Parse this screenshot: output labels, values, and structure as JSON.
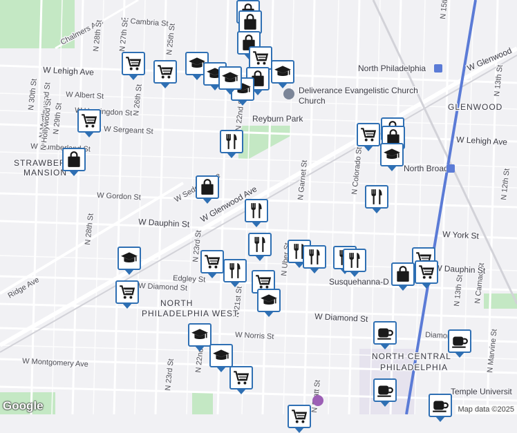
{
  "map": {
    "streets": [
      "W Cambria St",
      "Chalmers Ave",
      "W Lehigh Ave",
      "W Albert St",
      "W Huntingdon St",
      "W Sergeant St",
      "W Cumberland St",
      "W Sedgley Ave",
      "W Gordon St",
      "W Dauphin St",
      "W Glenwood Ave",
      "Ridge Ave",
      "W Diamond St",
      "Edgley St",
      "W Norris St",
      "W Montgomery Ave",
      "N 29th St",
      "N 28th St",
      "N 27th St",
      "N 26th St",
      "N 25th St",
      "N 22nd St",
      "N 23rd St",
      "N 21st St",
      "N Uber St",
      "N Garnet St",
      "N 30th St",
      "N Myrtlewood St",
      "N Hollywood St",
      "W York St",
      "N 13th St",
      "N Camac St",
      "N Marvine St",
      "N 12th St",
      "N Pratt St",
      "N Colorado St",
      "W Glenwood",
      "W Lehigh Ave",
      "N 15th St",
      "N 13th St",
      "Edgley St",
      "W Diamond St",
      "Susquehanna-D",
      "Diamond",
      "W Dauphin St",
      "N 28th St",
      "N 23rd St",
      "N 22nd St"
    ],
    "places": [
      "North Philadelphia",
      "Deliverance Evangelistic Church",
      "Reyburn Park",
      "North Broad",
      "Temple Universit"
    ],
    "areas": [
      "GLENWOOD",
      "STRAWBERRY MANSION",
      "NORTH PHILADELPHIA WEST",
      "NORTH CENTRAL PHILADELPHIA"
    ],
    "attribution": "Map data ©2025",
    "logo": "Google",
    "colors": {
      "pin_border": "#2e6fb3",
      "park": "#c4e8c4",
      "rail": "#5b7bd6",
      "road": "#ffffff",
      "background": "#f1f1f4"
    }
  },
  "pins": [
    {
      "icon": "shopping-bag-icon"
    },
    {
      "icon": "shopping-bag-icon"
    },
    {
      "icon": "shopping-bag-icon"
    },
    {
      "icon": "shopping-cart-icon"
    },
    {
      "icon": "school-icon"
    },
    {
      "icon": "shopping-cart-icon"
    },
    {
      "icon": "shopping-cart-icon"
    },
    {
      "icon": "school-icon"
    },
    {
      "icon": "school-icon"
    },
    {
      "icon": "shopping-bag-icon"
    },
    {
      "icon": "school-icon"
    },
    {
      "icon": "school-icon"
    },
    {
      "icon": "shopping-cart-icon"
    },
    {
      "icon": "restaurant-icon"
    },
    {
      "icon": "shopping-bag-icon"
    },
    {
      "icon": "shopping-bag-icon"
    },
    {
      "icon": "shopping-cart-icon"
    },
    {
      "icon": "shopping-bag-icon"
    },
    {
      "icon": "school-icon"
    },
    {
      "icon": "restaurant-icon"
    },
    {
      "icon": "shopping-bag-icon"
    },
    {
      "icon": "restaurant-icon"
    },
    {
      "icon": "restaurant-icon"
    },
    {
      "icon": "restaurant-icon"
    },
    {
      "icon": "restaurant-icon"
    },
    {
      "icon": "school-icon"
    },
    {
      "icon": "shopping-cart-icon"
    },
    {
      "icon": "restaurant-icon"
    },
    {
      "icon": "shopping-cart-icon"
    },
    {
      "icon": "shopping-cart-icon"
    },
    {
      "icon": "school-icon"
    },
    {
      "icon": "restaurant-icon"
    },
    {
      "icon": "restaurant-icon"
    },
    {
      "icon": "shopping-cart-icon"
    },
    {
      "icon": "shopping-bag-icon"
    },
    {
      "icon": "shopping-cart-icon"
    },
    {
      "icon": "coffee-icon"
    },
    {
      "icon": "coffee-icon"
    },
    {
      "icon": "school-icon"
    },
    {
      "icon": "school-icon"
    },
    {
      "icon": "shopping-cart-icon"
    },
    {
      "icon": "coffee-icon"
    },
    {
      "icon": "coffee-icon"
    },
    {
      "icon": "shopping-cart-icon"
    }
  ]
}
